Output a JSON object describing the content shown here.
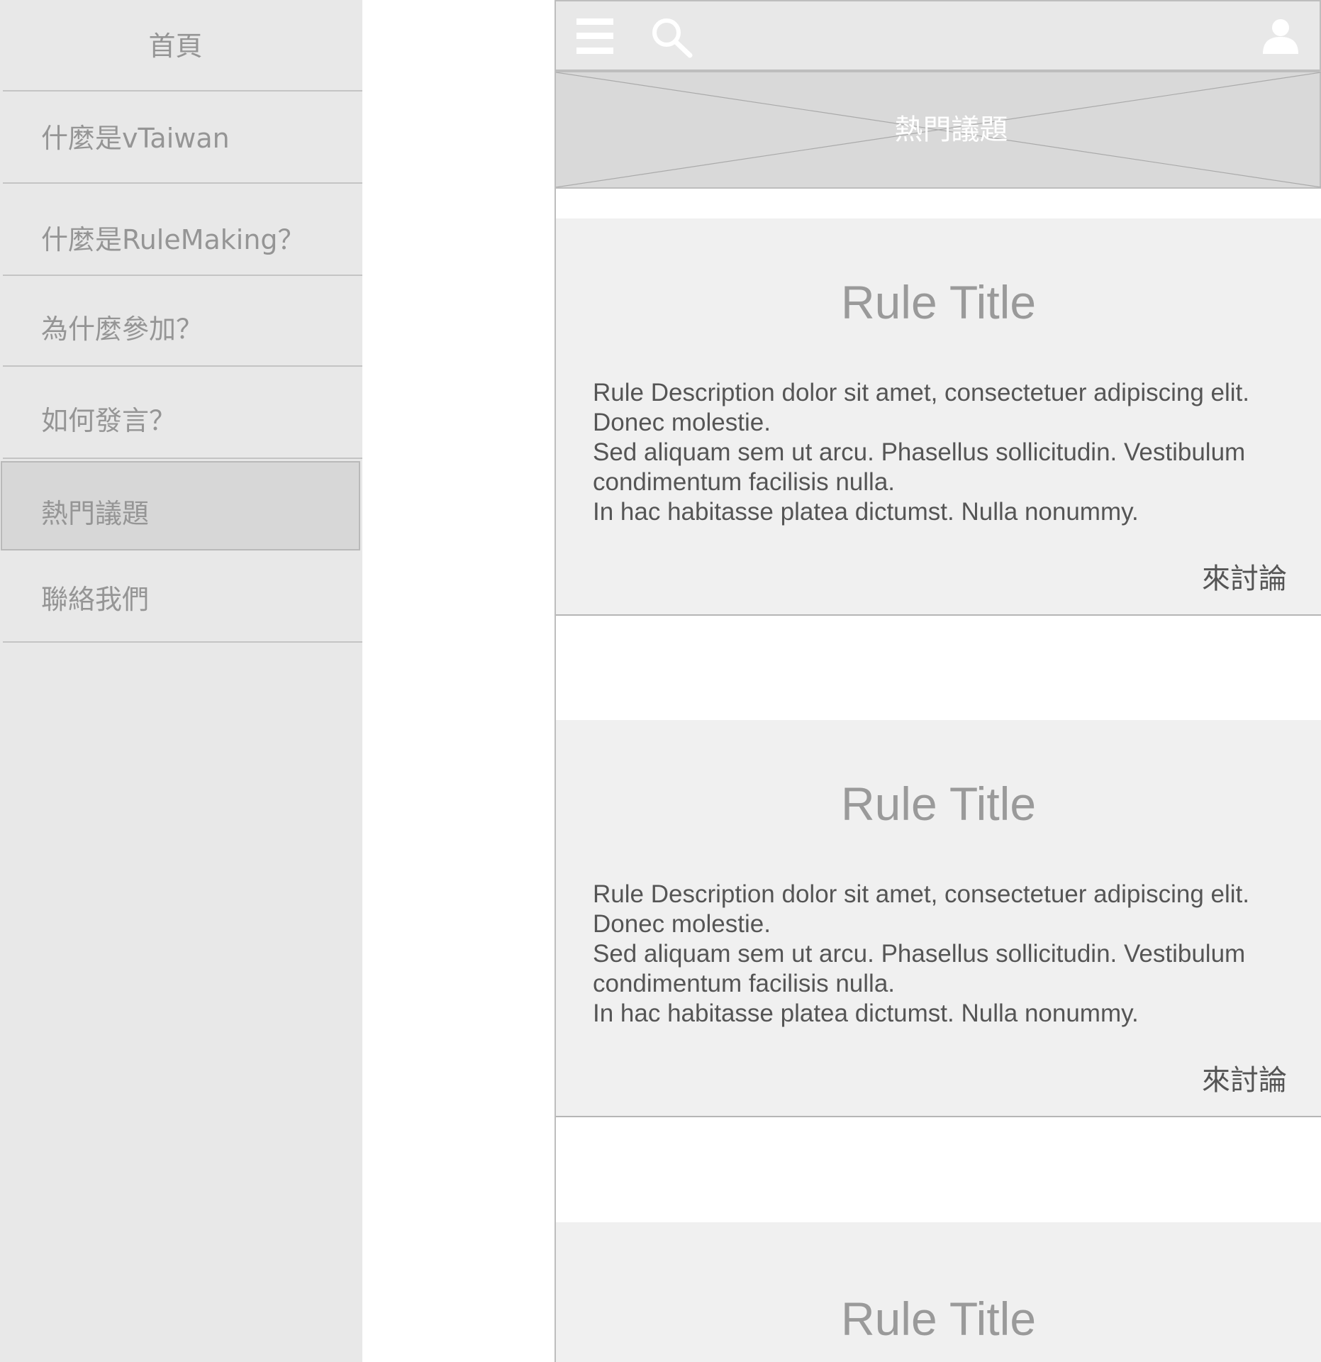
{
  "sidebar": {
    "items": [
      {
        "label": "首頁"
      },
      {
        "label": "什麼是vTaiwan"
      },
      {
        "label": "什麼是RuleMaking？"
      },
      {
        "label": "為什麼參加？"
      },
      {
        "label": "如何發言？"
      },
      {
        "label": "熱門議題",
        "active": true
      },
      {
        "label": "聯絡我們"
      }
    ]
  },
  "header": {
    "icons": [
      "menu-icon",
      "search-icon",
      "user-icon"
    ]
  },
  "hero": {
    "label": "熱門議題"
  },
  "cards": [
    {
      "title": "Rule Title",
      "description": [
        "Rule Description dolor sit amet, consectetuer adipiscing elit.",
        "Donec molestie.",
        "Sed aliquam sem ut arcu. Phasellus sollicitudin. Vestibulum",
        "condimentum facilisis nulla.",
        "In hac habitasse platea dictumst. Nulla nonummy."
      ],
      "link": "來討論"
    },
    {
      "title": "Rule Title",
      "description": [
        "Rule Description dolor sit amet, consectetuer adipiscing elit.",
        "Donec molestie.",
        "Sed aliquam sem ut arcu. Phasellus sollicitudin. Vestibulum",
        "condimentum facilisis nulla.",
        "In hac habitasse platea dictumst. Nulla nonummy."
      ],
      "link": "來討論"
    },
    {
      "title": "Rule Title"
    }
  ],
  "colors": {
    "sidebar_bg": "#e8e8e8",
    "active_bg": "#d7d7d7",
    "card_bg": "#f0f0f0",
    "hero_bg": "#d9d9d9"
  }
}
